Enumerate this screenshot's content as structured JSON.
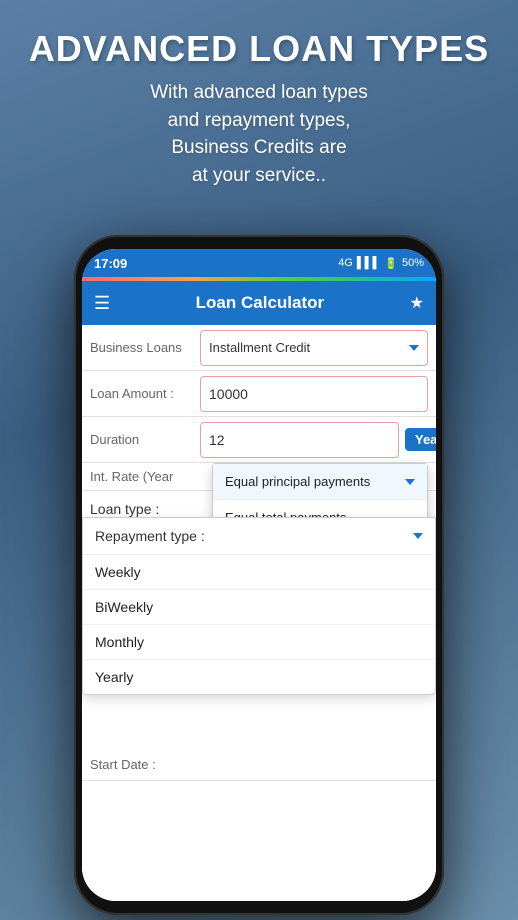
{
  "header": {
    "title": "ADVANCED LOAN TYPES",
    "subtitle": "With advanced loan types\nand repayment types,\nBusiness Credits are\nat your service.."
  },
  "phone": {
    "status_bar": {
      "time": "17:09",
      "signal": "4G",
      "battery": "50%"
    },
    "app_bar": {
      "title": "Loan Calculator",
      "menu_icon": "☰",
      "bookmark_icon": "★"
    },
    "form": {
      "loan_type_label": "Business Loans",
      "loan_type_value": "Installment Credit",
      "loan_amount_label": "Loan Amount :",
      "loan_amount_value": "10000",
      "duration_label": "Duration",
      "duration_value": "12",
      "duration_unit": "Years",
      "int_rate_label": "Int. Rate (Year",
      "loan_type_row_label": "Loan type :",
      "repayment_type_label": "Repayment type :",
      "start_date_label": "Start Date :"
    },
    "loan_type_dropdown": {
      "options": [
        "Equal principal payments",
        "Equal total payments"
      ],
      "selected": "Equal principal payments"
    },
    "repayment_dropdown": {
      "options": [
        "Weekly",
        "BiWeekly",
        "Monthly",
        "Yearly"
      ]
    },
    "chevron": "▼"
  }
}
